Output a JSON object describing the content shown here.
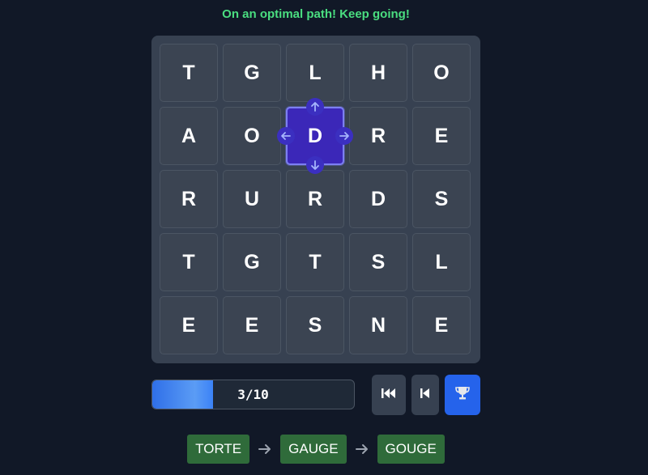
{
  "status_message": "On an optimal path! Keep going!",
  "board": {
    "rows": [
      [
        "T",
        "G",
        "L",
        "H",
        "O"
      ],
      [
        "A",
        "O",
        "D",
        "R",
        "E"
      ],
      [
        "R",
        "U",
        "R",
        "D",
        "S"
      ],
      [
        "T",
        "G",
        "T",
        "S",
        "L"
      ],
      [
        "E",
        "E",
        "S",
        "N",
        "E"
      ]
    ],
    "selected": {
      "row": 1,
      "col": 2
    }
  },
  "progress": {
    "label": "3/10",
    "current": 3,
    "total": 10
  },
  "controls": {
    "first_icon": "skip-to-start-icon",
    "prev_icon": "step-back-icon",
    "trophy_icon": "trophy-icon"
  },
  "word_chain": [
    "TORTE",
    "GAUGE",
    "GOUGE"
  ],
  "colors": {
    "status_text": "#4ade80",
    "selected_cell": "#3b27b8",
    "word_chip": "#2f6b3a",
    "trophy_button": "#2563eb",
    "progress_fill": "#3b82f6"
  }
}
